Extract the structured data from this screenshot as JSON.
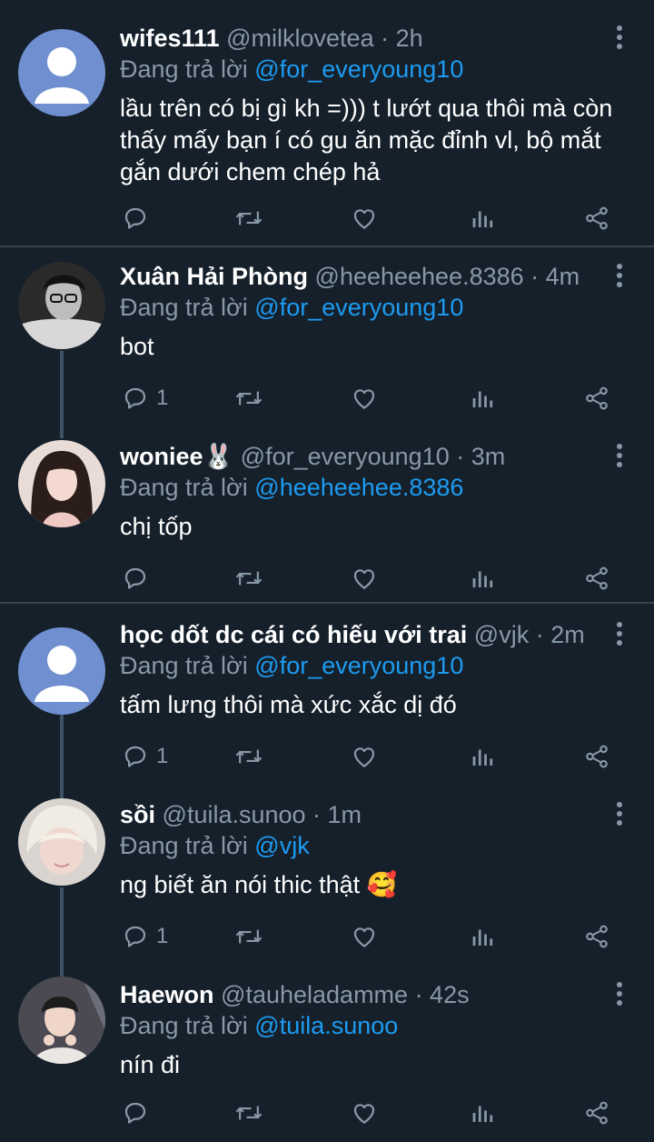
{
  "tweets": [
    {
      "name": "wifes111",
      "meta": "@milklovetea · 2h",
      "replying_prefix": "Đang trả lời",
      "replying_to": "@for_everyoung10",
      "text": "lầu trên có bị gì kh =))) t lướt qua thôi mà còn thấy mấy bạn í có gu ăn mặc đỉnh vl, bộ mắt gắn dưới chem chép hả",
      "reply_count": "",
      "avatar": "default-avatar"
    },
    {
      "name": "Xuân Hải Phòng",
      "meta": "@heeheehee.8386 · 4m",
      "replying_prefix": "Đang trả lời",
      "replying_to": "@for_everyoung10",
      "text": "bot",
      "reply_count": "1",
      "avatar": "photo-bw"
    },
    {
      "name": "woniee🐰",
      "meta": "@for_everyoung10 · 3m",
      "replying_prefix": "Đang trả lời",
      "replying_to": "@heeheehee.8386",
      "text": "chị tốp",
      "reply_count": "",
      "avatar": "photo-girl"
    },
    {
      "name": "học dốt dc cái có hiếu với trai",
      "meta": "@vjk · 2m",
      "replying_prefix": "Đang trả lời",
      "replying_to": "@for_everyoung10",
      "text": "tấm lưng thôi mà xức xắc dị đó",
      "reply_count": "1",
      "avatar": "default-avatar"
    },
    {
      "name": "sồi",
      "meta": "@tuila.sunoo · 1m",
      "replying_prefix": "Đang trả lời",
      "replying_to": "@vjk",
      "text": "ng biết ăn nói thic thật 🥰",
      "reply_count": "1",
      "avatar": "photo-blond"
    },
    {
      "name": "Haewon",
      "meta": "@tauheladamme · 42s",
      "replying_prefix": "Đang trả lời",
      "replying_to": "@tuila.sunoo",
      "text": "nín đi",
      "reply_count": "",
      "avatar": "photo-beanie"
    }
  ],
  "colors": {
    "background": "#15202b",
    "muted": "#8899a6",
    "link": "#1d9bf0",
    "divider": "#38444d",
    "thread_line": "#3d5466"
  },
  "icons": [
    "reply-icon",
    "retweet-icon",
    "like-icon",
    "views-icon",
    "share-icon",
    "more-icon"
  ]
}
